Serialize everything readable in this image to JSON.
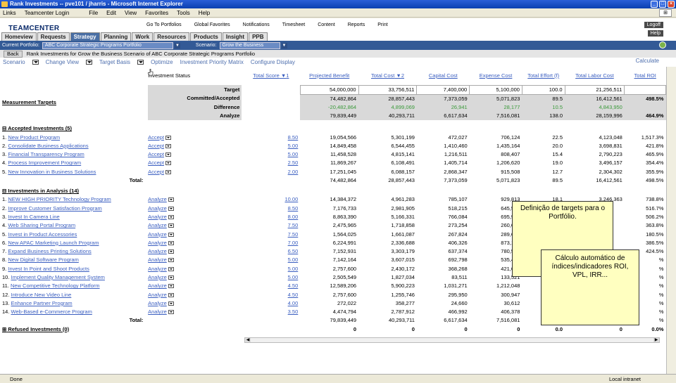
{
  "window": {
    "title": "Rank Investments -- pve101 / jharris - Microsoft Internet Explorer"
  },
  "menu": {
    "links": "Links",
    "teamcenter_login": "Teamcenter Login",
    "items": [
      "File",
      "Edit",
      "View",
      "Favorites",
      "Tools",
      "Help"
    ]
  },
  "app": {
    "logo": "TEAMCENTER",
    "top_links": [
      "Go To Portfolios",
      "Global Favorites",
      "Notifications",
      "Timesheet",
      "Content",
      "Reports",
      "Print"
    ],
    "logoff": "Logoff",
    "help": "Help",
    "tabs": [
      "Homeview",
      "Requests",
      "Strategy",
      "Planning",
      "Work",
      "Resources",
      "Products",
      "Insight",
      "PPB"
    ],
    "active_tab": "Strategy"
  },
  "portfolio_bar": {
    "current_label": "Current Portfolio:",
    "current_value": "ABC Corporate Strategic Programs Portfolio",
    "scenario_label": "Scenario:",
    "scenario_value": "Grow the Business"
  },
  "back_bar": {
    "back": "Back",
    "title": "Rank Investments for Grow the Business Scenario of ABC Corporate Strategic Programs Portfolio"
  },
  "options": [
    "Scenario",
    "Change View",
    "Target Basis",
    "Optimize",
    "Investment Priority Matrix",
    "Configure Display"
  ],
  "calculate": "Calculate",
  "columns": {
    "status": "Investment Status",
    "score": "Total Score",
    "score_rank": "1",
    "benefit": "Projected Benefit",
    "cost": "Total Cost",
    "cost_rank": "2",
    "capital": "Capital Cost",
    "expense": "Expense Cost",
    "effort": "Total Effort (f)",
    "labor": "Total Labor Cost",
    "roi": "Total ROI"
  },
  "targets": {
    "heading": "Measurement Targets",
    "labels": [
      "Target",
      "Committed/Accepted",
      "Difference",
      "Analyze"
    ],
    "rows": [
      [
        "54,000,000",
        "33,756,511",
        "7,400,000",
        "5,100,000",
        "100.0",
        "21,256,511",
        ""
      ],
      [
        "74,482,864",
        "28,857,443",
        "7,373,059",
        "5,071,823",
        "89.5",
        "16,412,561",
        "498.5%"
      ],
      [
        "-20,482,864",
        "4,899,069",
        "26,941",
        "28,177",
        "10.5",
        "4,843,950",
        ""
      ],
      [
        "79,839,449",
        "40,293,711",
        "6,617,634",
        "7,516,081",
        "138.0",
        "28,159,996",
        "464.9%"
      ]
    ]
  },
  "accepted": {
    "heading": "Accepted Investments (5)",
    "rows": [
      {
        "n": "1.",
        "name": "New Product Program",
        "status": "Accept",
        "score": "8.50",
        "benefit": "19,054,566",
        "cost": "5,301,199",
        "capital": "472,027",
        "expense": "706,124",
        "effort": "22.5",
        "labor": "4,123,048",
        "roi": "1,517.3%"
      },
      {
        "n": "2.",
        "name": "Consolidate Business Applications",
        "status": "Accept",
        "score": "5.00",
        "benefit": "14,849,458",
        "cost": "6,544,455",
        "capital": "1,410,460",
        "expense": "1,435,164",
        "effort": "20.0",
        "labor": "3,698,831",
        "roi": "421.8%"
      },
      {
        "n": "3.",
        "name": "Financial Transparency Program",
        "status": "Accept",
        "score": "5.00",
        "benefit": "11,458,528",
        "cost": "4,815,141",
        "capital": "1,216,511",
        "expense": "808,407",
        "effort": "15.4",
        "labor": "2,790,223",
        "roi": "465.9%"
      },
      {
        "n": "4.",
        "name": "Process Improvement Program",
        "status": "Accept",
        "score": "2.50",
        "benefit": "11,869,267",
        "cost": "6,108,491",
        "capital": "1,405,714",
        "expense": "1,206,620",
        "effort": "19.0",
        "labor": "3,496,157",
        "roi": "354.4%"
      },
      {
        "n": "5.",
        "name": "New Innovation in Business Solutions",
        "status": "Accept",
        "score": "2.00",
        "benefit": "17,251,045",
        "cost": "6,088,157",
        "capital": "2,868,347",
        "expense": "915,508",
        "effort": "12.7",
        "labor": "2,304,302",
        "roi": "355.9%"
      }
    ],
    "total_label": "Total:",
    "total": {
      "benefit": "74,482,864",
      "cost": "28,857,443",
      "capital": "7,373,059",
      "expense": "5,071,823",
      "effort": "89.5",
      "labor": "16,412,561",
      "roi": "498.5%"
    }
  },
  "analysis": {
    "heading": "Investments in Analysis (14)",
    "rows": [
      {
        "n": "1.",
        "name": "NEW HIGH PRIORITY Technology Program",
        "status": "Analyze",
        "score": "10.00",
        "benefit": "14,384,372",
        "cost": "4,961,283",
        "capital": "785,107",
        "expense": "929,813",
        "effort": "18.1",
        "labor": "3,246,363",
        "roi": "738.8%"
      },
      {
        "n": "2.",
        "name": "Improve Customer Satisfaction Program",
        "status": "Analyze",
        "score": "8.50",
        "benefit": "7,176,733",
        "cost": "2,981,905",
        "capital": "518,215",
        "expense": "645,572",
        "effort": "",
        "labor": "",
        "roi": "516.7%"
      },
      {
        "n": "3.",
        "name": "Invest In Camera Line",
        "status": "Analyze",
        "score": "8.00",
        "benefit": "8,863,390",
        "cost": "5,166,331",
        "capital": "766,084",
        "expense": "695,948",
        "effort": "",
        "labor": "",
        "roi": "506.2%"
      },
      {
        "n": "4.",
        "name": "Web Sharing Portal Program",
        "status": "Analyze",
        "score": "7.50",
        "benefit": "2,475,965",
        "cost": "1,718,858",
        "capital": "273,254",
        "expense": "260,637",
        "effort": "",
        "labor": "",
        "roi": "363.8%"
      },
      {
        "n": "5.",
        "name": "Invest in Product Accessories",
        "status": "Analyze",
        "score": "7.50",
        "benefit": "1,564,025",
        "cost": "1,661,087",
        "capital": "267,824",
        "expense": "289,686",
        "effort": "",
        "labor": "",
        "roi": "180.5%"
      },
      {
        "n": "6.",
        "name": "New APAC Marketing Launch Program",
        "status": "Analyze",
        "score": "7.00",
        "benefit": "6,224,991",
        "cost": "2,336,688",
        "capital": "406,326",
        "expense": "873,180",
        "effort": "",
        "labor": "",
        "roi": "386.5%"
      },
      {
        "n": "7.",
        "name": "Expand Business Printing Solutions",
        "status": "Analyze",
        "score": "6.50",
        "benefit": "7,152,931",
        "cost": "3,303,179",
        "capital": "637,374",
        "expense": "780,594",
        "effort": "",
        "labor": "",
        "roi": "424.5%"
      },
      {
        "n": "8.",
        "name": "New Digital Software Program",
        "status": "Analyze",
        "score": "5.00",
        "benefit": "7,142,164",
        "cost": "3,607,015",
        "capital": "692,798",
        "expense": "535,495",
        "effort": "",
        "labor": "",
        "roi": "%"
      },
      {
        "n": "9.",
        "name": "Invest In Point and Shoot Products",
        "status": "Analyze",
        "score": "5.00",
        "benefit": "2,757,600",
        "cost": "2,430,172",
        "capital": "368,268",
        "expense": "421,650",
        "effort": "",
        "labor": "",
        "roi": "%"
      },
      {
        "n": "10.",
        "name": "Implement Quality Management System",
        "status": "Analyze",
        "score": "5.00",
        "benefit": "2,505,549",
        "cost": "1,827,034",
        "capital": "83,511",
        "expense": "133,521",
        "effort": "",
        "labor": "",
        "roi": "%"
      },
      {
        "n": "11.",
        "name": "New Competitive Technology Platform",
        "status": "Analyze",
        "score": "4.50",
        "benefit": "12,589,206",
        "cost": "5,900,223",
        "capital": "1,031,271",
        "expense": "1,212,048",
        "effort": "",
        "labor": "",
        "roi": "%"
      },
      {
        "n": "12.",
        "name": "Introduce New Video Line",
        "status": "Analyze",
        "score": "4.50",
        "benefit": "2,757,600",
        "cost": "1,255,746",
        "capital": "295,950",
        "expense": "300,947",
        "effort": "",
        "labor": "",
        "roi": "%"
      },
      {
        "n": "13.",
        "name": "Enhance Partner Program",
        "status": "Analyze",
        "score": "4.00",
        "benefit": "272,022",
        "cost": "358,277",
        "capital": "24,660",
        "expense": "30,612",
        "effort": "",
        "labor": "",
        "roi": "%"
      },
      {
        "n": "14.",
        "name": "Web-Based e-Commerce Program",
        "status": "Analyze",
        "score": "3.50",
        "benefit": "4,474,794",
        "cost": "2,787,912",
        "capital": "466,992",
        "expense": "406,378",
        "effort": "",
        "labor": "",
        "roi": "%"
      }
    ],
    "total_label": "Total:",
    "total": {
      "benefit": "79,839,449",
      "cost": "40,293,711",
      "capital": "6,617,634",
      "expense": "7,516,081",
      "effort": "13",
      "labor": "",
      "roi": "%"
    }
  },
  "refused": {
    "heading": "Refused Investments (0)",
    "total": {
      "benefit": "0",
      "cost": "0",
      "capital": "0",
      "expense": "0",
      "effort": "0.0",
      "labor": "0",
      "roi": "0.0%"
    }
  },
  "notes": [
    "Definição de targets para o Portfólio.",
    "Cálculo automático de índices/indicadores ROI, VPL, IRR..."
  ],
  "status": {
    "done": "Done",
    "zone": "Local intranet"
  }
}
